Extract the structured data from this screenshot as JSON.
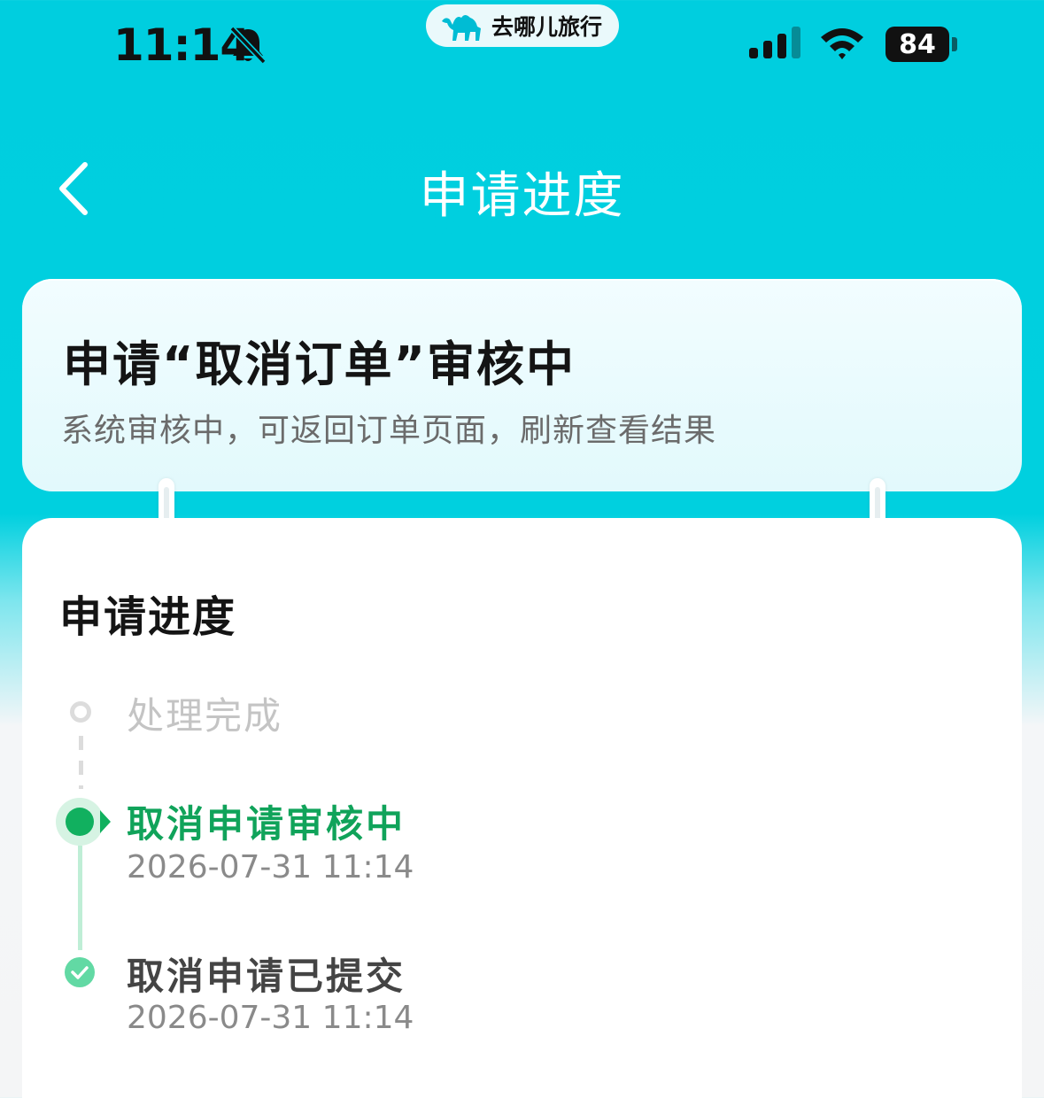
{
  "status_bar": {
    "time": "11:14",
    "app_name": "去哪儿旅行",
    "battery": "84"
  },
  "nav": {
    "title": "申请进度"
  },
  "status_card": {
    "title": "申请“取消订单”审核中",
    "subtitle": "系统审核中，可返回订单页面，刷新查看结果"
  },
  "progress": {
    "heading": "申请进度",
    "steps": [
      {
        "label": "处理完成",
        "state": "pending",
        "time": ""
      },
      {
        "label": "取消申请审核中",
        "state": "current",
        "time": "2026-07-31 11:14"
      },
      {
        "label": "取消申请已提交",
        "state": "done",
        "time": "2026-07-31 11:14"
      }
    ]
  },
  "colors": {
    "header_bg": "#00cedf",
    "current_green": "#10a35a",
    "done_green": "#62d9a4",
    "pending_gray": "#c4c4c4"
  },
  "icons": {
    "status": [
      "bell-off-icon",
      "signal-icon",
      "wifi-icon",
      "battery-icon"
    ],
    "app": "camel-logo-icon",
    "nav": "chevron-left-icon",
    "done": "check-icon"
  }
}
